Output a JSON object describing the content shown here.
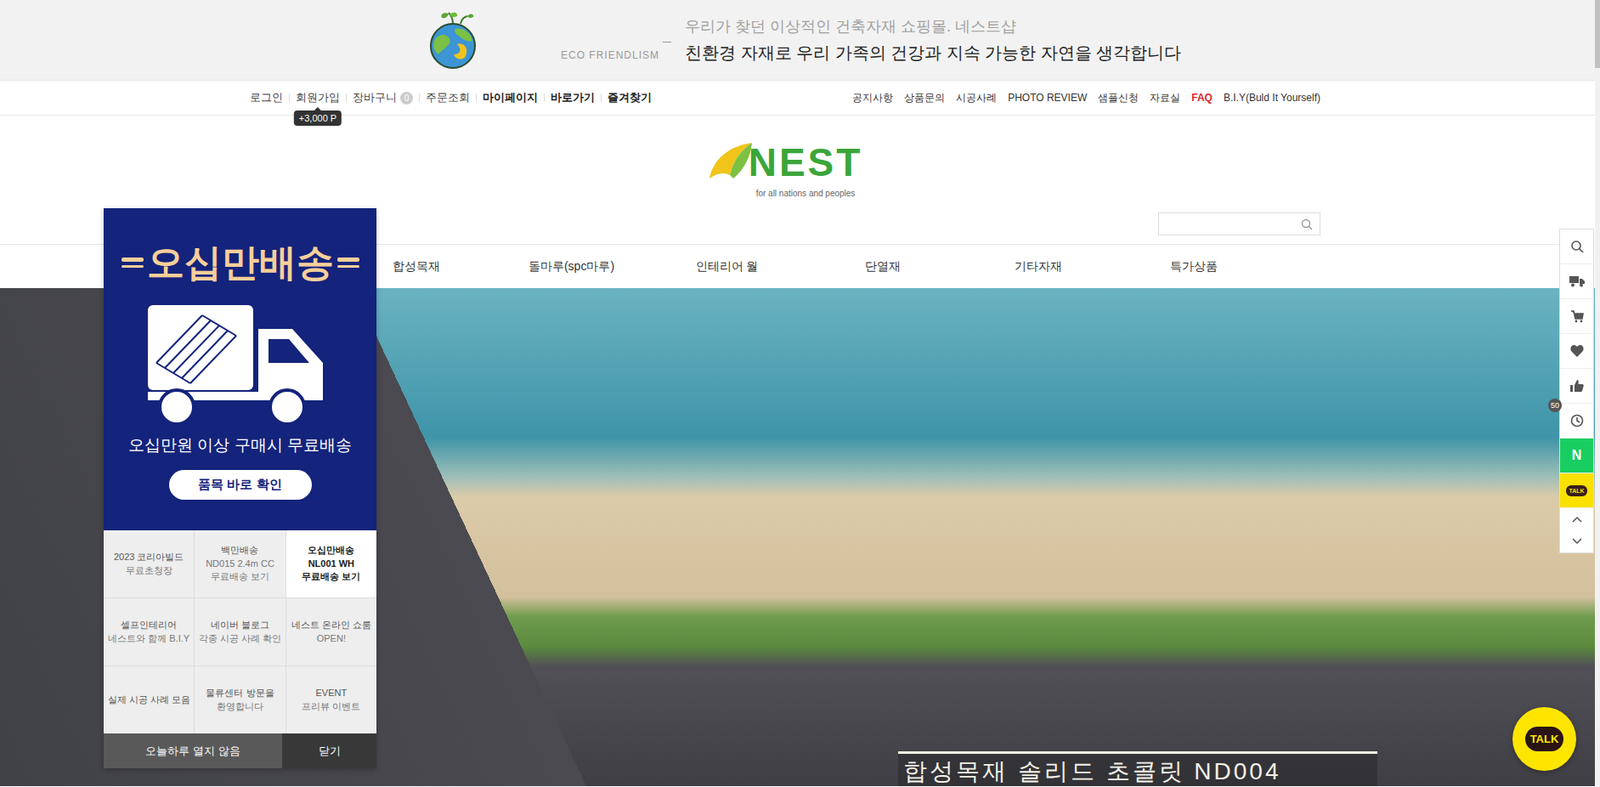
{
  "top_banner": {
    "tagline": "ECO FRIENDLISM",
    "headline": "우리가 찾던 이상적인 건축자재 쇼핑몰. 네스트샵",
    "subheadline": "친환경 자재로 우리 가족의 건강과 지속 가능한 자연을 생각합니다"
  },
  "account_links": [
    {
      "label": "로그인",
      "bold": false
    },
    {
      "label": "회원가입",
      "bold": false,
      "tooltip": "+3,000 P"
    },
    {
      "label": "장바구니",
      "bold": false,
      "badge": "0"
    },
    {
      "label": "주문조회",
      "bold": false
    },
    {
      "label": "마이페이지",
      "bold": true
    },
    {
      "label": "바로가기",
      "bold": true
    },
    {
      "label": "즐겨찾기",
      "bold": true
    }
  ],
  "info_links": [
    {
      "label": "공지사항",
      "highlight": false
    },
    {
      "label": "상품문의",
      "highlight": false
    },
    {
      "label": "시공사례",
      "highlight": false
    },
    {
      "label": "PHOTO REVIEW",
      "highlight": false
    },
    {
      "label": "샘플신청",
      "highlight": false
    },
    {
      "label": "자료실",
      "highlight": false
    },
    {
      "label": "FAQ",
      "highlight": true
    },
    {
      "label": "B.I.Y(Buld It Yourself)",
      "highlight": false
    }
  ],
  "logo": {
    "name": "NEST",
    "slogan": "for all nations and peoples"
  },
  "search": {
    "placeholder": ""
  },
  "categories": [
    "합성목재",
    "돌마루(spc마루)",
    "인테리어 월",
    "단열재",
    "기타자재",
    "특가상품"
  ],
  "hero": {
    "caption": "합성목재 솔리드 초콜릿 ND004"
  },
  "popup": {
    "title": "오십만배송",
    "description": "오십만원 이상 구매시 무료배송",
    "button": "품목 바로 확인",
    "tiles": [
      {
        "lines": [
          "2023 코리아빌드",
          "무료초청장"
        ],
        "selected": false
      },
      {
        "lines": [
          "백만배송",
          "ND015 2.4m CC",
          "무료배송 보기"
        ],
        "selected": false
      },
      {
        "lines": [
          "오십만배송",
          "NL001 WH",
          "무료배송 보기"
        ],
        "selected": true
      },
      {
        "lines": [
          "셀프인테리어",
          "네스트와 함께 B.I.Y"
        ],
        "selected": false
      },
      {
        "lines": [
          "네이버 블로그",
          "각종 시공 사례 확인"
        ],
        "selected": false
      },
      {
        "lines": [
          "네스트 온라인 쇼룸",
          "OPEN!"
        ],
        "selected": false
      },
      {
        "lines": [
          "실제 시공 사례 모음"
        ],
        "selected": false
      },
      {
        "lines": [
          "물류센터 방문을",
          "환영합니다"
        ],
        "selected": false
      },
      {
        "lines": [
          "EVENT",
          "프리뷰 이벤트"
        ],
        "selected": false
      }
    ],
    "footer": {
      "dismiss_today": "오늘하루 열지 않음",
      "close": "닫기"
    }
  },
  "quick_menu": [
    {
      "kind": "search"
    },
    {
      "kind": "delivery"
    },
    {
      "kind": "cart"
    },
    {
      "kind": "wishlist"
    },
    {
      "kind": "like"
    },
    {
      "kind": "recent",
      "badge": "50"
    },
    {
      "kind": "naver",
      "label": "N"
    },
    {
      "kind": "kakao",
      "label": "TALK"
    },
    {
      "kind": "up"
    },
    {
      "kind": "down"
    }
  ],
  "chat_button": {
    "label": "TALK"
  }
}
